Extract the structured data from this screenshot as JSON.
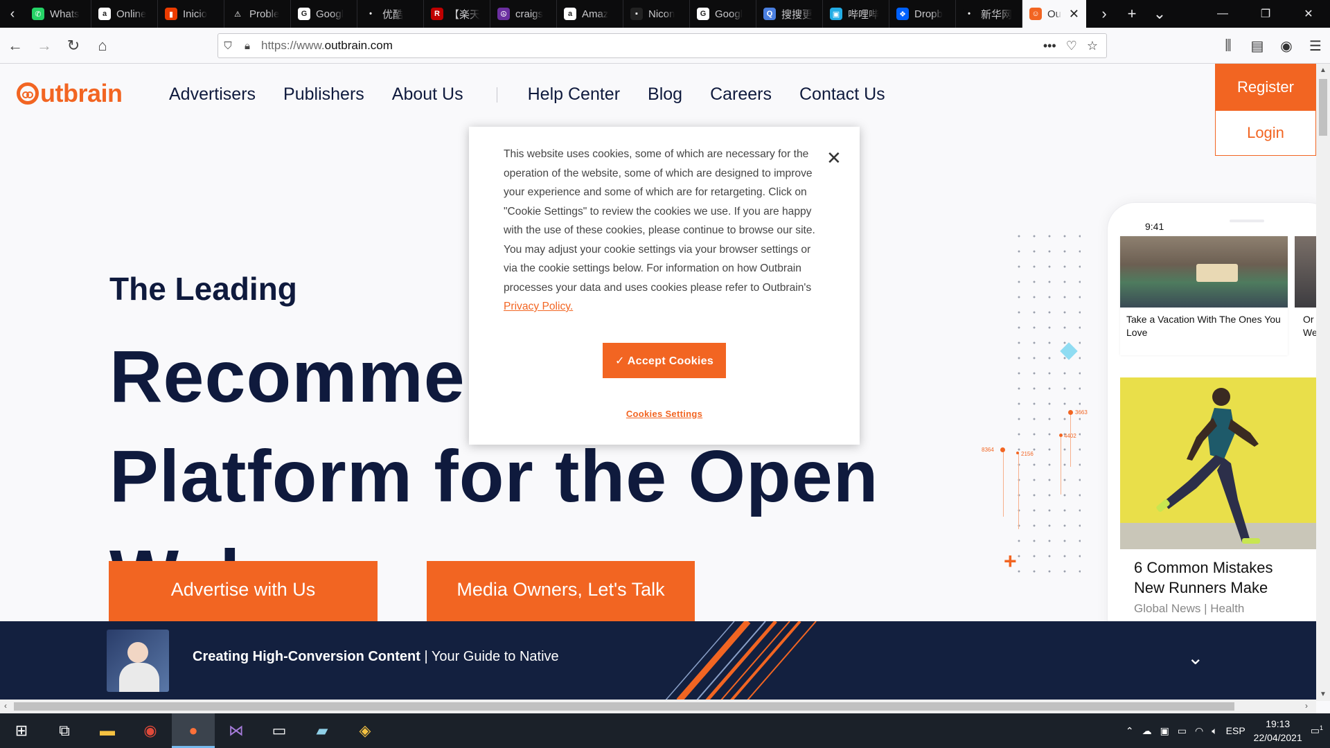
{
  "browser": {
    "tabs": [
      {
        "label": "Whats",
        "fav_color": "#25d366",
        "fav_glyph": "✆"
      },
      {
        "label": "Online",
        "fav_color": "#ffffff",
        "fav_glyph": "a"
      },
      {
        "label": "Inicio",
        "fav_color": "#eb3c00",
        "fav_glyph": "▮"
      },
      {
        "label": "Proble",
        "fav_color": "#0c0c0d",
        "fav_glyph": "⚠"
      },
      {
        "label": "Googl",
        "fav_color": "#ffffff",
        "fav_glyph": "G"
      },
      {
        "label": "优酷",
        "fav_color": "#0c0c0d",
        "fav_glyph": "•"
      },
      {
        "label": "【楽天",
        "fav_color": "#bf0000",
        "fav_glyph": "R"
      },
      {
        "label": "craigs",
        "fav_color": "#6b2fa0",
        "fav_glyph": "☮"
      },
      {
        "label": "Amaz",
        "fav_color": "#ffffff",
        "fav_glyph": "a"
      },
      {
        "label": "Nicon",
        "fav_color": "#222222",
        "fav_glyph": "▪"
      },
      {
        "label": "Googl",
        "fav_color": "#ffffff",
        "fav_glyph": "G"
      },
      {
        "label": "搜搜更",
        "fav_color": "#4a7fe0",
        "fav_glyph": "Q"
      },
      {
        "label": "哔哩哔",
        "fav_color": "#23ade5",
        "fav_glyph": "▣"
      },
      {
        "label": "Dropb",
        "fav_color": "#0061fe",
        "fav_glyph": "❖"
      },
      {
        "label": "新华网",
        "fav_color": "#0c0c0d",
        "fav_glyph": "•"
      }
    ],
    "active_tab": {
      "label": "Ou",
      "fav_color": "#f26522",
      "fav_glyph": "☺"
    },
    "url_prefix": "https://www.",
    "url_domain": "outbrain.com"
  },
  "site": {
    "logo_text": "utbrain",
    "nav_primary": [
      "Advertisers",
      "Publishers",
      "About Us"
    ],
    "nav_secondary": [
      "Help Center",
      "Blog",
      "Careers",
      "Contact Us"
    ],
    "register_label": "Register",
    "login_label": "Login",
    "hero_sub": "The Leading",
    "hero_title": "Recommendation Platform for the Open Web",
    "cta_advertise": "Advertise with Us",
    "cta_media": "Media Owners, Let's Talk",
    "chart_labels": [
      "8364",
      "3663",
      "4402",
      "2156"
    ]
  },
  "phone": {
    "time": "9:41",
    "card1_title": "Take a Vacation With The Ones You Love",
    "card1b_title": "Or We",
    "card2_title": "6 Common Mistakes New Runners Make",
    "card2_source": "Global News | Health"
  },
  "cookie": {
    "text": "This website uses cookies, some of which are necessary for the operation of the website, some of which are designed to improve your experience and some of which are for retargeting. Click on \"Cookie Settings\" to review the cookies we use. If you are happy with the use of these cookies, please continue to browse our site. You may adjust your cookie settings via your browser settings or via the cookie settings below. For information on how Outbrain processes your data and uses cookies please refer to Outbrain's ",
    "privacy_link": "Privacy Policy.",
    "accept_label": "✓ Accept Cookies",
    "settings_label": "Cookies Settings"
  },
  "banner": {
    "title_bold": "Creating High-Conversion Content",
    "title_rest": " | Your Guide to Native"
  },
  "taskbar": {
    "lang": "ESP",
    "time": "19:13",
    "date": "22/04/2021",
    "notif_count": "1"
  }
}
